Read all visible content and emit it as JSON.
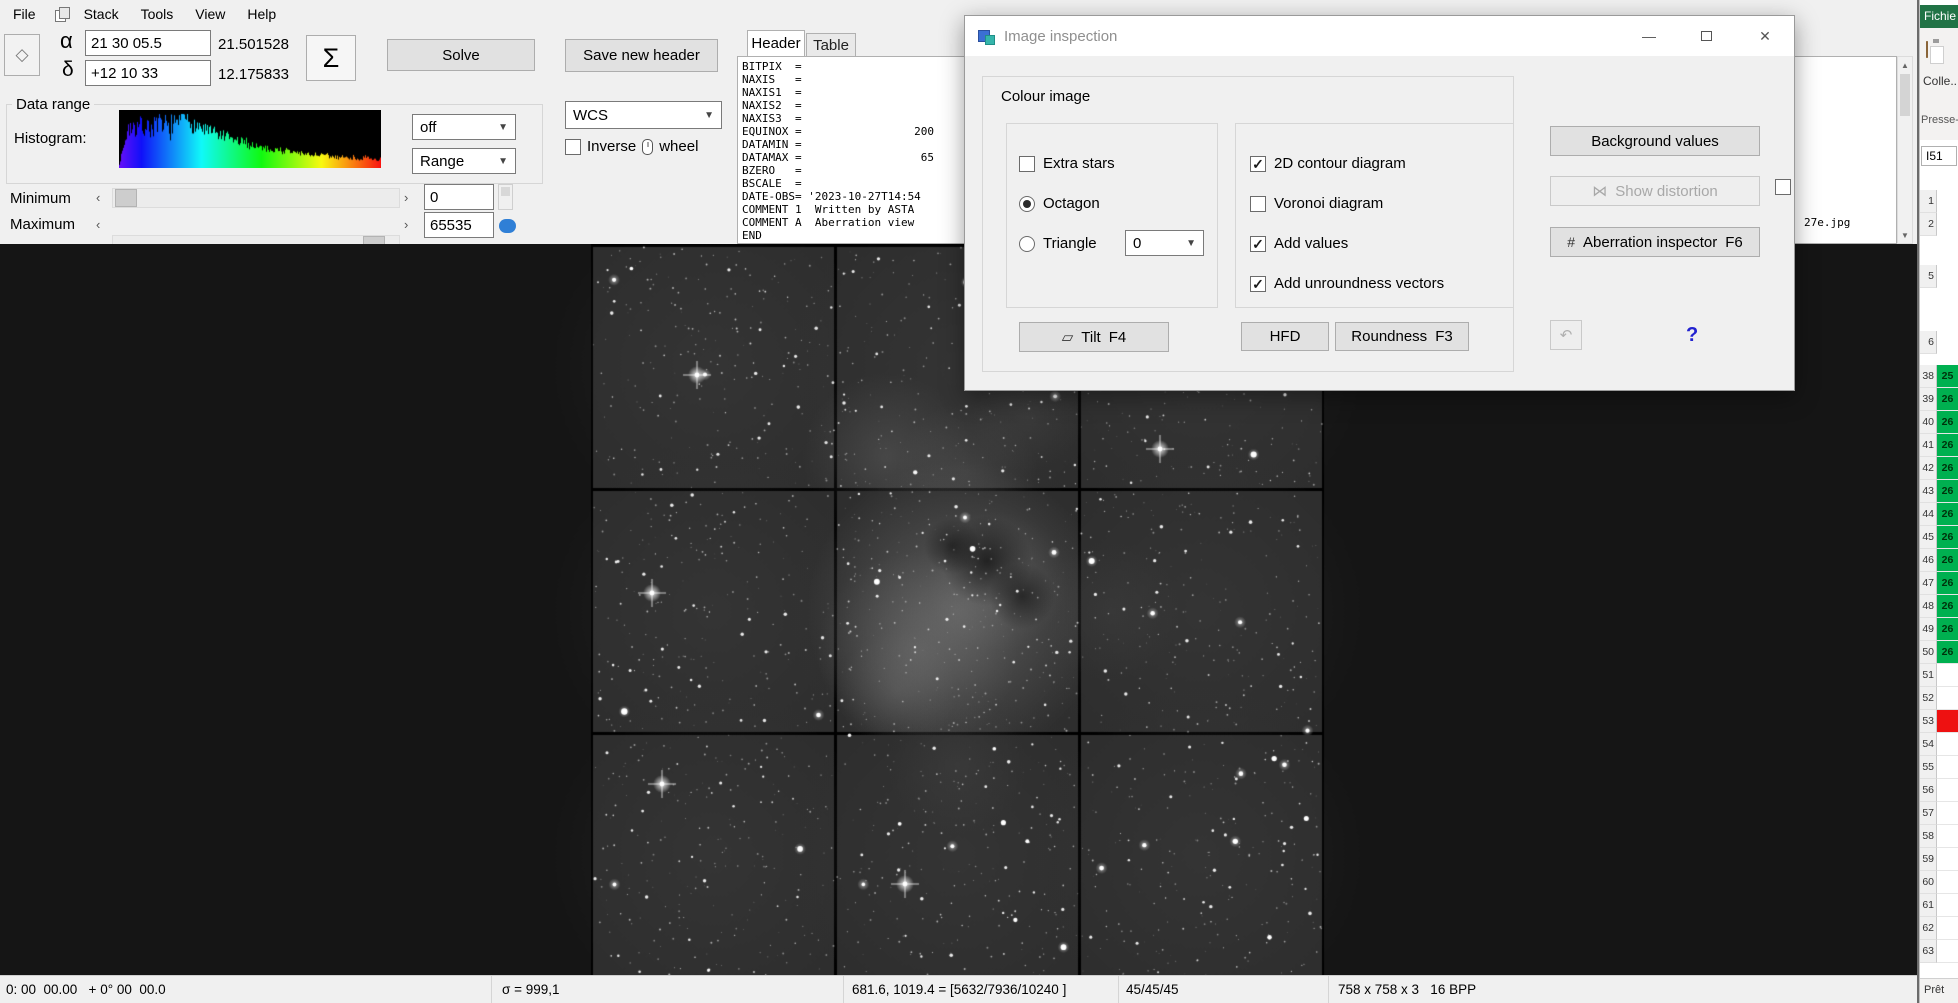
{
  "menu": {
    "items": [
      "File",
      "Stack",
      "Tools",
      "View",
      "Help"
    ]
  },
  "pointing": {
    "alpha_label": "α",
    "alpha_value": "21 30 05.5",
    "alpha_degrees": "21.501528",
    "delta_label": "δ",
    "delta_value": "+12 10 33",
    "delta_degrees": "12.175833",
    "sigma_label": "Σ",
    "solve_label": "Solve",
    "save_header_label": "Save new header"
  },
  "header_panel": {
    "tab_header": "Header",
    "tab_table": "Table",
    "lines": [
      "BITPIX  =",
      "NAXIS   =",
      "NAXIS1  =",
      "NAXIS2  =",
      "NAXIS3  =",
      "EQUINOX =                 200",
      "DATAMIN =",
      "DATAMAX =                  65",
      "BZERO   =",
      "BSCALE  =",
      "DATE-OBS= '2023-10-27T14:54",
      "COMMENT 1  Written by ASTA",
      "COMMENT A  Aberration view",
      "END"
    ],
    "comment_tail": "27e.jpg"
  },
  "data_range": {
    "group_label": "Data range",
    "histogram_label": "Histogram:",
    "stretch_value": "off",
    "range_value": "Range",
    "wcs_value": "WCS",
    "inverse_label": "Inverse",
    "wheel_label": "wheel",
    "minimum_label": "Minimum",
    "maximum_label": "Maximum",
    "minimum_value": "0",
    "maximum_value": "65535",
    "slider_left_arrow": "‹",
    "slider_right_arrow": "›"
  },
  "dialog": {
    "title": "Image inspection",
    "section_label": "Colour image",
    "extra_stars": {
      "label": "Extra stars",
      "checked": false
    },
    "octagon": {
      "label": "Octagon",
      "checked": true
    },
    "triangle": {
      "label": "Triangle",
      "checked": false
    },
    "triangle_count": "0",
    "contour": {
      "label": "2D contour diagram",
      "checked": true
    },
    "voronoi": {
      "label": "Voronoi diagram",
      "checked": false
    },
    "add_values": {
      "label": "Add values",
      "checked": true
    },
    "unroundness": {
      "label": "Add unroundness vectors",
      "checked": true
    },
    "tilt": {
      "label": "Tilt",
      "key": "F4"
    },
    "hfd_label": "HFD",
    "roundness": {
      "label": "Roundness",
      "key": "F3"
    },
    "background_values_label": "Background values",
    "show_distortion_label": "Show distortion",
    "distortion_checked": false,
    "aberration": {
      "label": "Aberration inspector",
      "key": "F6"
    },
    "help_label": "?"
  },
  "status_bar": {
    "coordinates": "0: 00  00.00   + 0° 00  00.0",
    "sigma": "σ = 999,1",
    "pixel_info": "681.6, 1019.4 = [5632/7936/10240 ]",
    "rgb": "45/45/45",
    "image_info": "758 x 758 x 3   16 BPP"
  },
  "spreadsheet": {
    "file_tab": "Fichie",
    "paste_label": "Colle..",
    "clipboard_group": "Presse-p",
    "name_box": "I51",
    "upper_rows": [
      "1",
      "2",
      "5",
      "6"
    ],
    "rows": [
      {
        "n": "38",
        "v": "25",
        "c": "green"
      },
      {
        "n": "39",
        "v": "26",
        "c": "green"
      },
      {
        "n": "40",
        "v": "26",
        "c": "green"
      },
      {
        "n": "41",
        "v": "26",
        "c": "green"
      },
      {
        "n": "42",
        "v": "26",
        "c": "green"
      },
      {
        "n": "43",
        "v": "26",
        "c": "green"
      },
      {
        "n": "44",
        "v": "26",
        "c": "green"
      },
      {
        "n": "45",
        "v": "26",
        "c": "green"
      },
      {
        "n": "46",
        "v": "26",
        "c": "green"
      },
      {
        "n": "47",
        "v": "26",
        "c": "green"
      },
      {
        "n": "48",
        "v": "26",
        "c": "green"
      },
      {
        "n": "49",
        "v": "26",
        "c": "green"
      },
      {
        "n": "50",
        "v": "26",
        "c": "green"
      },
      {
        "n": "51",
        "v": "",
        "c": ""
      },
      {
        "n": "52",
        "v": "",
        "c": ""
      },
      {
        "n": "53",
        "v": "",
        "c": "red"
      },
      {
        "n": "54",
        "v": "",
        "c": ""
      },
      {
        "n": "55",
        "v": "",
        "c": ""
      },
      {
        "n": "56",
        "v": "",
        "c": ""
      },
      {
        "n": "57",
        "v": "",
        "c": ""
      },
      {
        "n": "58",
        "v": "",
        "c": ""
      },
      {
        "n": "59",
        "v": "",
        "c": ""
      },
      {
        "n": "60",
        "v": "",
        "c": ""
      },
      {
        "n": "61",
        "v": "",
        "c": ""
      },
      {
        "n": "62",
        "v": "",
        "c": ""
      },
      {
        "n": "63",
        "v": "",
        "c": ""
      }
    ],
    "status": "Prêt"
  }
}
